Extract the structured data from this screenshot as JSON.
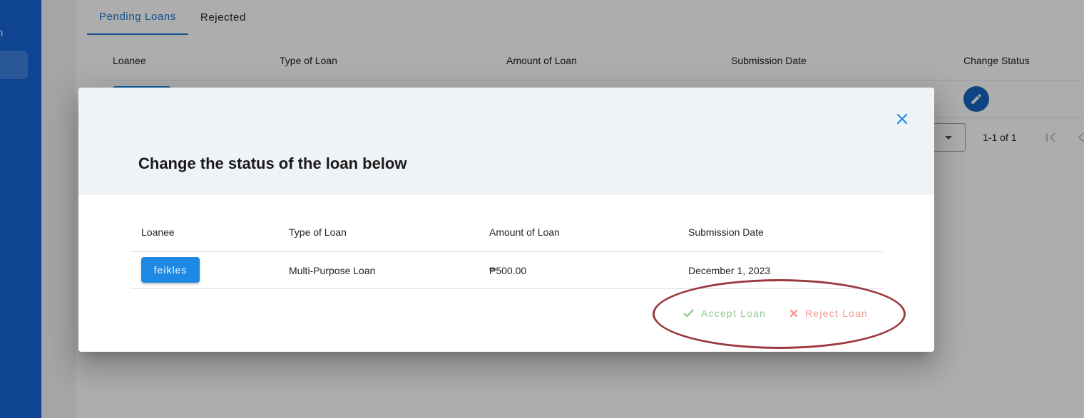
{
  "sidebar": {
    "partial_label": "n"
  },
  "tabs": [
    {
      "label": "Pending Loans",
      "active": true
    },
    {
      "label": "Rejected",
      "active": false
    }
  ],
  "table": {
    "columns": [
      "Loanee",
      "Type of Loan",
      "Amount of Loan",
      "Submission Date",
      "Change Status"
    ],
    "pagination": {
      "range": "1-1 of 1"
    }
  },
  "dialog": {
    "title": "Change the status of the loan below",
    "columns": [
      "Loanee",
      "Type of Loan",
      "Amount of Loan",
      "Submission Date"
    ],
    "row": {
      "loanee": "feikles",
      "type": "Multi-Purpose Loan",
      "amount": "₱500.00",
      "date": "December 1, 2023"
    },
    "actions": {
      "accept_label": "Accept Loan",
      "reject_label": "Reject Loan"
    }
  },
  "icons": {
    "close": "close-icon",
    "edit": "pencil-icon",
    "accept": "check-icon",
    "reject": "x-icon",
    "pager_first": "first-page-icon",
    "pager_prev": "chevron-left-icon",
    "select_caret": "caret-down-icon"
  },
  "colors": {
    "sidebar": "#1565d8",
    "primary": "#1976d2",
    "chip": "#1e88e5",
    "accept": "#8fcf92",
    "reject": "#f29a94",
    "annotation": "#9b3a3d",
    "dialog_header": "#eff3f7"
  }
}
